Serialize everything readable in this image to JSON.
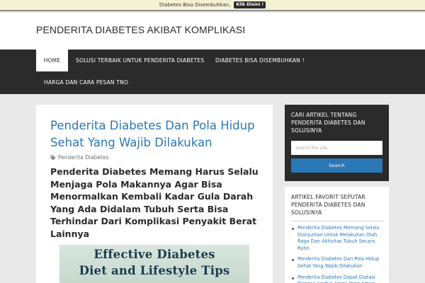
{
  "announcement": {
    "text": "Diabetes Bisa Disembuhkan,",
    "button": "Klik Disini !"
  },
  "site": {
    "title": "PENDERITA DIABETES AKIBAT KOMPLIKASI"
  },
  "nav": {
    "items": [
      {
        "label": "HOME",
        "active": true
      },
      {
        "label": "SOLUSI TERBAIK UNTUK PENDERITA DIABETES",
        "active": false
      },
      {
        "label": "DIABETES BISA DISEMBUHKAN !",
        "active": false
      },
      {
        "label": "HARGA DAN CARA PESAN TNO",
        "active": false
      }
    ]
  },
  "post": {
    "title": "Penderita Diabetes Dan Pola Hidup Sehat Yang Wajib Dilakukan",
    "category": "Penderita Diabetes",
    "heading": "Penderita Diabetes Memang Harus Selalu Menjaga Pola Makannya Agar Bisa Menormalkan Kembali Kadar Gula Darah Yang Ada Didalam Tubuh Serta Bisa Terhindar Dari Komplikasi Penyakit Berat Lainnya",
    "image_text": {
      "line1": "Effective Diabetes",
      "line2": "Diet and Lifestyle Tips"
    }
  },
  "sidebar": {
    "search_widget": {
      "title": "CARI ARTIKEL TENTANG PENDERITA DIABETES DAN SOLUSINYA",
      "placeholder": "Search the site",
      "button": "Search"
    },
    "favorites_widget": {
      "title": "ARTIKEL FAVORIT SEPUTAR PENDERITA DIABETES DAN SOLUSINYA",
      "items": [
        "Penderita Diabetes Memang Selalu Dianjurkan Untuk Melakukan Olah Raga Dan Aktivitas Tubuh Secara Rutin",
        "Penderita Diabetes Dan Pola Hidup Sehat Yang Wajib Dilakukan",
        "Penderita Diabetes Dapat Diatasi Dengan Herbal Alami Yang Aman"
      ]
    }
  },
  "colors": {
    "accent": "#2b78b7",
    "nav_bg": "#2b2b2b",
    "page_bg": "#e9e9e9"
  }
}
